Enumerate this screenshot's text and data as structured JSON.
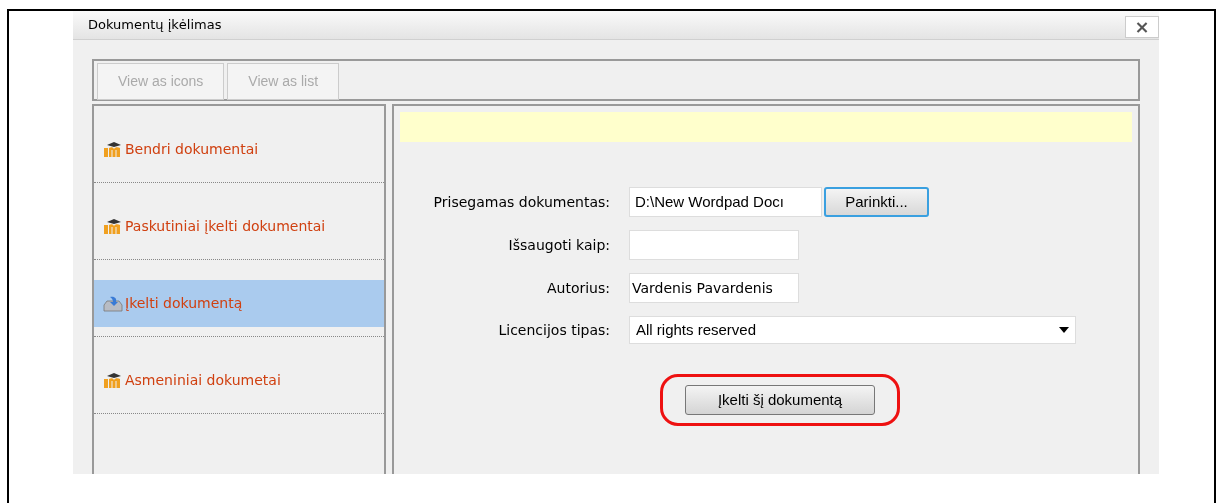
{
  "dialog": {
    "title": "Dokumentų įkėlimas",
    "close": "×"
  },
  "toolbar": [
    {
      "label": "View as icons"
    },
    {
      "label": "View as list"
    }
  ],
  "sidebar": {
    "items": [
      {
        "label": "Bendri dokumentai",
        "kind": "repository",
        "selected": false
      },
      {
        "label": "Paskutiniai įkelti dokumentai",
        "kind": "repository",
        "selected": false
      },
      {
        "label": "Įkelti dokumentą",
        "kind": "upload",
        "selected": true
      },
      {
        "label": "Asmeniniai dokumetai",
        "kind": "repository",
        "selected": false
      }
    ]
  },
  "form": {
    "fields": [
      {
        "label": "Prisegamas dokumentas:",
        "kind": "file",
        "value": "D:\\New Wordpad Docı",
        "button": "Parinkti..."
      },
      {
        "label": "Išsaugoti kaip:",
        "kind": "text"
      },
      {
        "label": "Autorius:",
        "kind": "text",
        "value": "Vardenis Pavardenis"
      },
      {
        "label": "Licencijos tipas:",
        "kind": "select",
        "value": "All rights reserved"
      }
    ],
    "submit": {
      "label": "Įkelti šį dokumentą",
      "highlighted": true
    }
  }
}
